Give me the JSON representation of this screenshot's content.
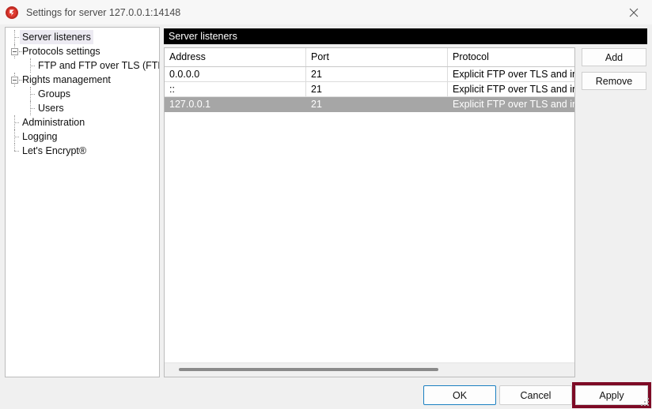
{
  "window": {
    "title": "Settings for server 127.0.0.1:14148",
    "app_icon": "filezilla-icon",
    "close_icon": "close-icon",
    "accent_focus_color": "#1a7fc1",
    "highlight_color": "#7d0a25"
  },
  "tree": {
    "items": [
      {
        "label": "Server listeners",
        "level": 1,
        "selected": true,
        "toggle": "none"
      },
      {
        "label": "Protocols settings",
        "level": 1,
        "selected": false,
        "toggle": "minus"
      },
      {
        "label": "FTP and FTP over TLS (FTPS)",
        "level": 2,
        "selected": false,
        "toggle": "none"
      },
      {
        "label": "Rights management",
        "level": 1,
        "selected": false,
        "toggle": "minus"
      },
      {
        "label": "Groups",
        "level": 2,
        "selected": false,
        "toggle": "none"
      },
      {
        "label": "Users",
        "level": 2,
        "selected": false,
        "toggle": "none"
      },
      {
        "label": "Administration",
        "level": 1,
        "selected": false,
        "toggle": "none"
      },
      {
        "label": "Logging",
        "level": 1,
        "selected": false,
        "toggle": "none"
      },
      {
        "label": "Let's Encrypt®",
        "level": 1,
        "selected": false,
        "toggle": "none"
      }
    ]
  },
  "section": {
    "header": "Server listeners"
  },
  "listeners_table": {
    "columns": [
      "Address",
      "Port",
      "Protocol"
    ],
    "rows": [
      {
        "address": "0.0.0.0",
        "port": "21",
        "protocol": "Explicit FTP over TLS and inse",
        "selected": false
      },
      {
        "address": "::",
        "port": "21",
        "protocol": "Explicit FTP over TLS and inse",
        "selected": false
      },
      {
        "address": "127.0.0.1",
        "port": "21",
        "protocol": "Explicit FTP over TLS and inse",
        "selected": true
      }
    ]
  },
  "side_buttons": {
    "add": "Add",
    "remove": "Remove"
  },
  "bottom_buttons": {
    "ok": "OK",
    "cancel": "Cancel",
    "apply": "Apply"
  }
}
